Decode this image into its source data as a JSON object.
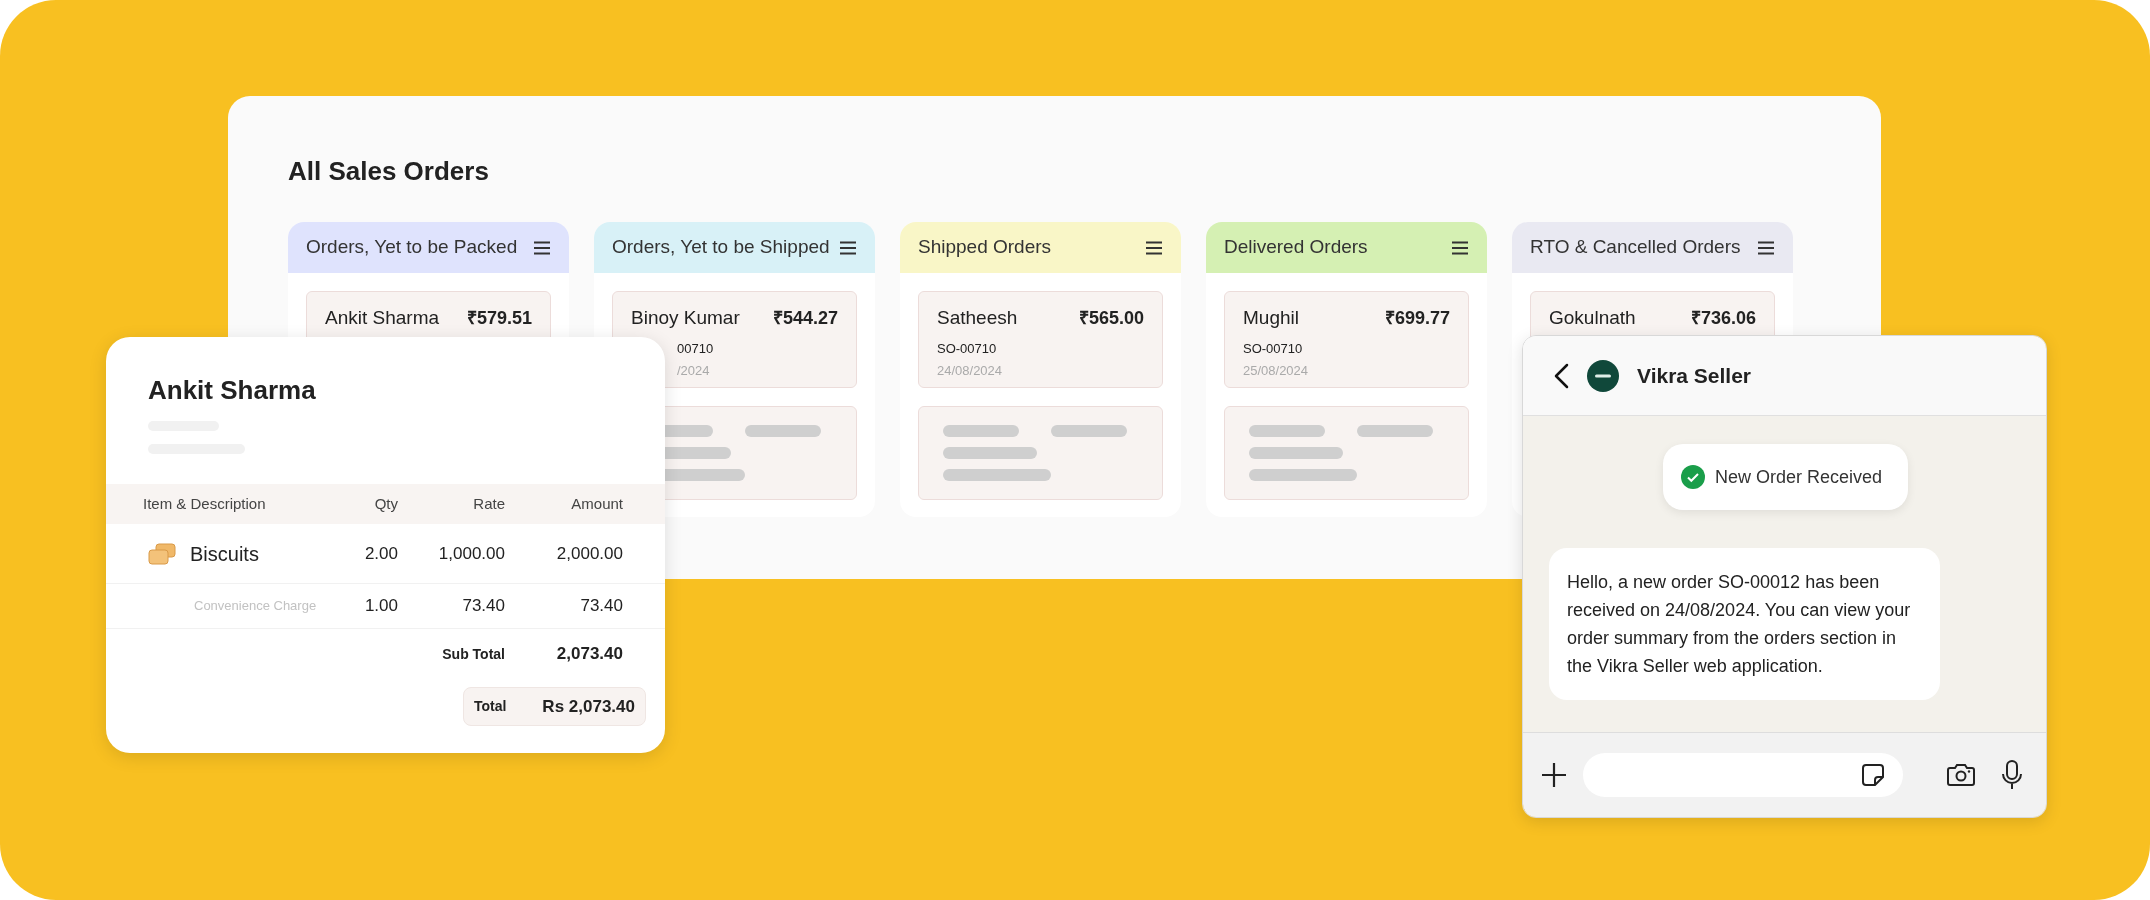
{
  "board": {
    "title": "All Sales Orders",
    "columns": [
      {
        "title": "Orders, Yet to be Packed",
        "color": "#dfe3fd",
        "cards": [
          {
            "kind": "order",
            "name": "Ankit Sharma",
            "amount": "₹579.51"
          }
        ]
      },
      {
        "title": "Orders, Yet to be Shipped",
        "color": "#d8f1f7",
        "cards": [
          {
            "kind": "order",
            "name": "Binoy Kumar",
            "amount": "₹544.27",
            "so": "00710",
            "date": "/2024",
            "clipped": true
          },
          {
            "kind": "placeholder"
          }
        ]
      },
      {
        "title": "Shipped Orders",
        "color": "#f9f6c7",
        "cards": [
          {
            "kind": "order",
            "name": "Satheesh",
            "amount": "₹565.00",
            "so": "SO-00710",
            "date": "24/08/2024",
            "clipped": false
          },
          {
            "kind": "placeholder"
          }
        ]
      },
      {
        "title": "Delivered Orders",
        "color": "#d5f0b3",
        "cards": [
          {
            "kind": "order",
            "name": "Mughil",
            "amount": "₹699.77",
            "so": "SO-00710",
            "date": "25/08/2024",
            "clipped": false
          },
          {
            "kind": "placeholder"
          }
        ]
      },
      {
        "title": "RTO & Cancelled Orders",
        "color": "#e9e9f2",
        "cards": [
          {
            "kind": "order",
            "name": "Gokulnath",
            "amount": "₹736.06"
          }
        ]
      }
    ]
  },
  "invoice": {
    "customer": "Ankit Sharma",
    "columns": [
      "Item & Description",
      "Qty",
      "Rate",
      "Amount"
    ],
    "rows": [
      {
        "kind": "item",
        "description": "Biscuits",
        "qty": "2.00",
        "rate": "1,000.00",
        "amount": "2,000.00"
      },
      {
        "kind": "charge",
        "description": "Convenience Charge",
        "qty": "1.00",
        "rate": "73.40",
        "amount": "73.40"
      }
    ],
    "sub_total": {
      "label": "Sub Total",
      "value": "2,073.40"
    },
    "total": {
      "label": "Total",
      "value": "Rs 2,073.40"
    }
  },
  "chat": {
    "title": "Vikra Seller",
    "toast": "New Order Received",
    "message": "Hello, a new order SO-00012 has been received on 24/08/2024. You can view your order summary from the orders section in the Vikra Seller web application."
  }
}
